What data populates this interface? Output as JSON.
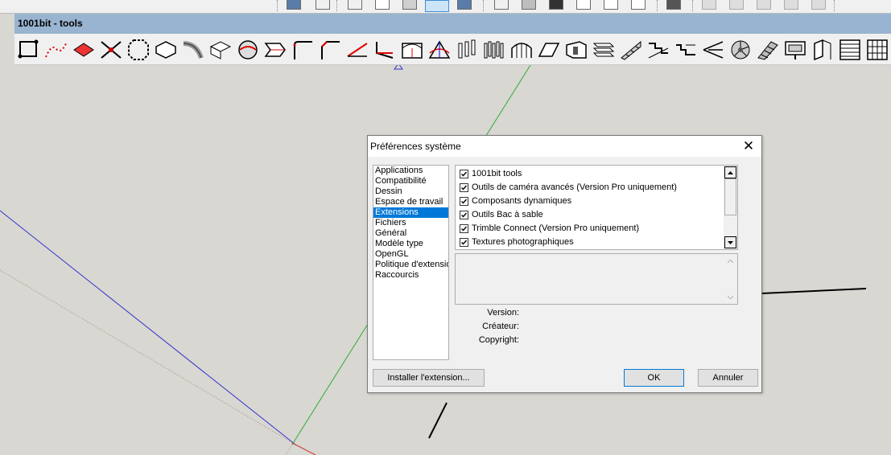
{
  "toolbar_window": {
    "title": "1001bit - tools"
  },
  "toolbar_icons": [
    "polyline-points-icon",
    "dotted-curve-icon",
    "red-face-icon",
    "line-intersect-icon",
    "octagon-icon",
    "offset-shape-icon",
    "bent-pipe-icon",
    "box-top-icon",
    "sphere-cut-icon",
    "arrow-box-icon",
    "fillet-corner-icon",
    "chamfer-corner-icon",
    "red-line-icon",
    "angle-corner-icon",
    "window-frame-icon",
    "roof-pitch-icon",
    "columns-icon",
    "column-row-icon",
    "arched-frame-icon",
    "plane-fold-icon",
    "wall-opening-icon",
    "stacked-slabs-icon",
    "stair-ramp-icon",
    "stair-steps-icon",
    "stair-flight-icon",
    "stair-landing-icon",
    "spiral-stair-icon",
    "stair-cut-icon",
    "monitor-window-icon",
    "door-frame-icon",
    "louver-icon",
    "grid-panel-icon"
  ],
  "dialog": {
    "title": "Préférences système",
    "categories": [
      "Applications",
      "Compatibilité",
      "Dessin",
      "Espace de travail",
      "Extensions",
      "Fichiers",
      "Général",
      "Modèle type",
      "OpenGL",
      "Politique d'extensio",
      "Raccourcis"
    ],
    "selected_category": "Extensions",
    "extensions": [
      {
        "label": "1001bit tools",
        "checked": true
      },
      {
        "label": "Outils de caméra avancés (Version Pro uniquement)",
        "checked": true
      },
      {
        "label": "Composants dynamiques",
        "checked": true
      },
      {
        "label": "Outils Bac à sable",
        "checked": true
      },
      {
        "label": "Trimble Connect  (Version Pro uniquement)",
        "checked": true
      },
      {
        "label": "Textures photographiques",
        "checked": true
      }
    ],
    "meta": {
      "version_label": "Version:",
      "creator_label": "Créateur:",
      "copyright_label": "Copyright:"
    },
    "buttons": {
      "install": "Installer l'extension...",
      "ok": "OK",
      "cancel": "Annuler"
    }
  },
  "colors": {
    "toolbar_title_bg": "#99b4d1",
    "selection": "#0078d7",
    "axis_blue": "#3333cc",
    "axis_green": "#33aa33",
    "axis_red": "#cc3333"
  }
}
